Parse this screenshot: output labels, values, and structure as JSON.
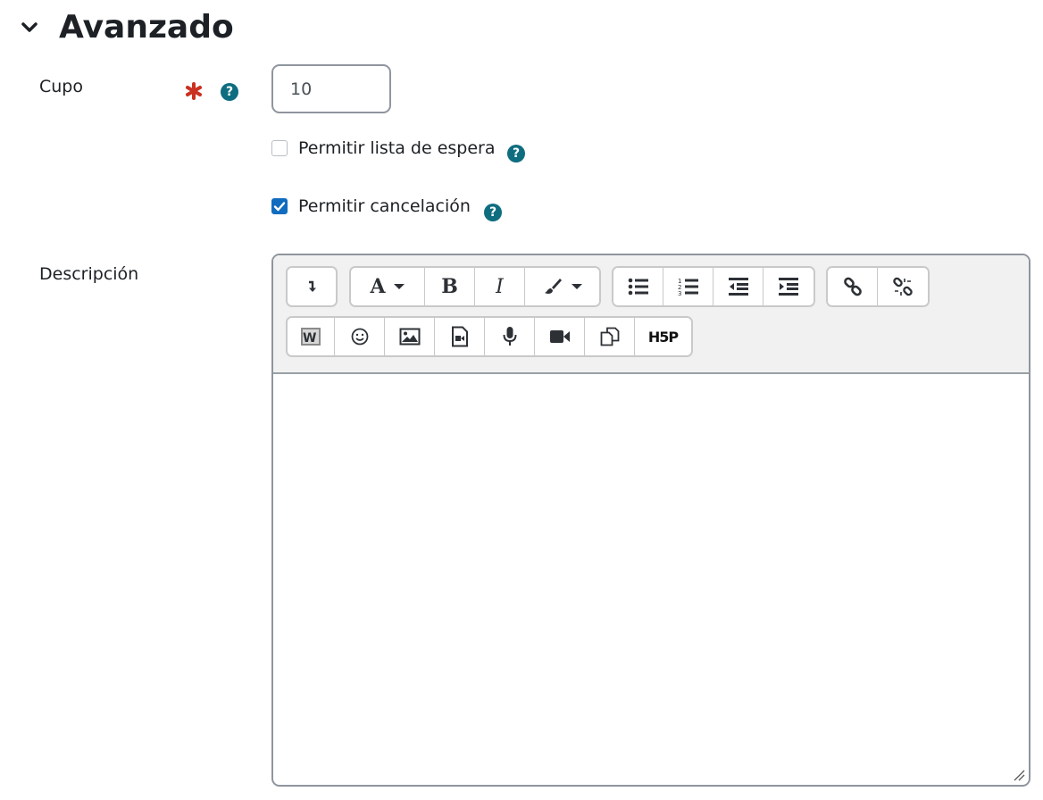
{
  "section": {
    "title": "Avanzado",
    "icon": "chevron-down-icon"
  },
  "fields": {
    "cupo": {
      "label": "Cupo",
      "value": "10",
      "required": true,
      "help_icon": "?"
    },
    "waitlist": {
      "label": "Permitir lista de espera",
      "checked": false,
      "help_icon": "?"
    },
    "cancel": {
      "label": "Permitir cancelación",
      "checked": true,
      "help_icon": "?"
    },
    "description": {
      "label": "Descripción",
      "value": ""
    }
  },
  "toolbar": {
    "row1": [
      [
        "toggle-toolbar-icon"
      ],
      [
        "font-style-icon",
        "bold-icon",
        "italic-icon",
        "text-color-icon"
      ],
      [
        "unordered-list-icon",
        "ordered-list-icon",
        "outdent-icon",
        "indent-icon"
      ],
      [
        "link-icon",
        "unlink-icon"
      ]
    ],
    "row2": [
      [
        "word-paste-icon",
        "emoji-icon",
        "image-icon",
        "media-icon",
        "record-audio-icon",
        "record-video-icon",
        "manage-files-icon",
        "h5p-icon"
      ]
    ],
    "bold_label": "B",
    "italic_label": "I",
    "font_label": "A",
    "h5p_label": "H5P"
  },
  "colors": {
    "help": "#0f6d80",
    "required": "#ca3120",
    "checkbox_checked": "#0f6cbf",
    "toolbar_bg": "#f1f1f1"
  }
}
